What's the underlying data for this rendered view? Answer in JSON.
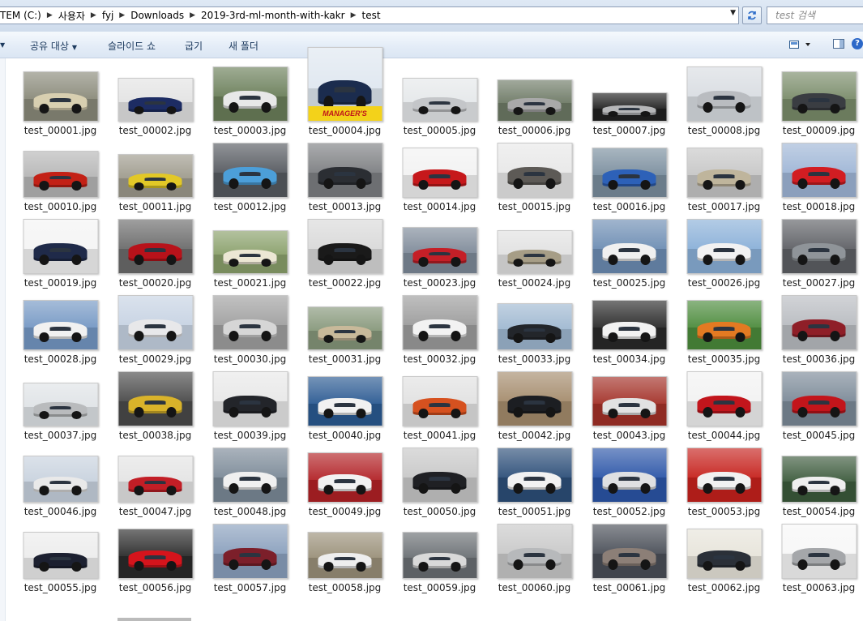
{
  "address": {
    "crumbs": [
      "TEM (C:)",
      "사용자",
      "fyj",
      "Downloads",
      "2019-3rd-ml-month-with-kakr",
      "test"
    ],
    "search_placeholder": "test 검색"
  },
  "toolbar": {
    "share": "공유 대상",
    "slideshow": "슬라이드 쇼",
    "burn": "굽기",
    "new_folder": "새 폴더"
  },
  "files": [
    {
      "name": "test_00001.jpg",
      "color": "#d8cfb0",
      "bg": "#8a8a7a",
      "w": 91,
      "h": 60
    },
    {
      "name": "test_00002.jpg",
      "color": "#1d2c63",
      "bg": "#e3e3e3",
      "w": 91,
      "h": 52
    },
    {
      "name": "test_00003.jpg",
      "color": "#e8e8e8",
      "bg": "#6b7f5a",
      "w": 91,
      "h": 66
    },
    {
      "name": "test_00004.jpg",
      "color": "#1b2c4e",
      "bg": "#dfe7f0",
      "w": 91,
      "h": 90,
      "banner": "MANAGER'S SPECIAL!"
    },
    {
      "name": "test_00005.jpg",
      "color": "#c4c6c9",
      "bg": "#e5e8ea",
      "w": 91,
      "h": 52
    },
    {
      "name": "test_00006.jpg",
      "color": "#a9a9a9",
      "bg": "#6e7a66",
      "w": 91,
      "h": 50
    },
    {
      "name": "test_00007.jpg",
      "color": "#b5b6b8",
      "bg": "#222222",
      "w": 91,
      "h": 34
    },
    {
      "name": "test_00008.jpg",
      "color": "#b9bcc0",
      "bg": "#d9dde2",
      "w": 91,
      "h": 66
    },
    {
      "name": "test_00009.jpg",
      "color": "#3a3d42",
      "bg": "#7a8c6a",
      "w": 91,
      "h": 60
    },
    {
      "name": "test_00010.jpg",
      "color": "#c32116",
      "bg": "#b6b6b6",
      "w": 91,
      "h": 56
    },
    {
      "name": "test_00011.jpg",
      "color": "#e2c827",
      "bg": "#9e9a8c",
      "w": 91,
      "h": 52
    },
    {
      "name": "test_00012.jpg",
      "color": "#4c9fd9",
      "bg": "#565a60",
      "w": 91,
      "h": 66
    },
    {
      "name": "test_00013.jpg",
      "color": "#2b2e33",
      "bg": "#7d7f82",
      "w": 91,
      "h": 66
    },
    {
      "name": "test_00014.jpg",
      "color": "#c6181b",
      "bg": "#f2f2f2",
      "w": 91,
      "h": 60
    },
    {
      "name": "test_00015.jpg",
      "color": "#5d5a56",
      "bg": "#e8e8e8",
      "w": 91,
      "h": 66
    },
    {
      "name": "test_00016.jpg",
      "color": "#2d61b8",
      "bg": "#7a8e9e",
      "w": 91,
      "h": 60
    },
    {
      "name": "test_00017.jpg",
      "color": "#bfb59c",
      "bg": "#c7c7c7",
      "w": 91,
      "h": 60
    },
    {
      "name": "test_00018.jpg",
      "color": "#d21d22",
      "bg": "#9fb6d6",
      "w": 91,
      "h": 66
    },
    {
      "name": "test_00019.jpg",
      "color": "#1f2a49",
      "bg": "#f4f4f4",
      "w": 91,
      "h": 66
    },
    {
      "name": "test_00020.jpg",
      "color": "#b8121a",
      "bg": "#6b6b6b",
      "w": 91,
      "h": 66
    },
    {
      "name": "test_00021.jpg",
      "color": "#ece7d4",
      "bg": "#8aa06b",
      "w": 91,
      "h": 52
    },
    {
      "name": "test_00022.jpg",
      "color": "#1a1a1a",
      "bg": "#d9d9d9",
      "w": 91,
      "h": 66
    },
    {
      "name": "test_00023.jpg",
      "color": "#c51f27",
      "bg": "#7e8a99",
      "w": 91,
      "h": 56
    },
    {
      "name": "test_00024.jpg",
      "color": "#a69d86",
      "bg": "#e1e1e1",
      "w": 91,
      "h": 52
    },
    {
      "name": "test_00025.jpg",
      "color": "#f0f0f0",
      "bg": "#6d8db3",
      "w": 91,
      "h": 66
    },
    {
      "name": "test_00026.jpg",
      "color": "#f2f2f2",
      "bg": "#8ab0d8",
      "w": 91,
      "h": 66
    },
    {
      "name": "test_00027.jpg",
      "color": "#8f9499",
      "bg": "#5e6065",
      "w": 91,
      "h": 66
    },
    {
      "name": "test_00028.jpg",
      "color": "#f1f1f1",
      "bg": "#7598c4",
      "w": 91,
      "h": 60
    },
    {
      "name": "test_00029.jpg",
      "color": "#e8e8ea",
      "bg": "#c7d3e3",
      "w": 91,
      "h": 66
    },
    {
      "name": "test_00030.jpg",
      "color": "#d6d6d6",
      "bg": "#a0a0a0",
      "w": 91,
      "h": 66
    },
    {
      "name": "test_00031.jpg",
      "color": "#c8b99a",
      "bg": "#86977a",
      "w": 91,
      "h": 52
    },
    {
      "name": "test_00032.jpg",
      "color": "#f2f2f2",
      "bg": "#9c9c9c",
      "w": 91,
      "h": 66
    },
    {
      "name": "test_00033.jpg",
      "color": "#23262b",
      "bg": "#9fb8d1",
      "w": 91,
      "h": 56
    },
    {
      "name": "test_00034.jpg",
      "color": "#f2f2f2",
      "bg": "#2a2a2a",
      "w": 91,
      "h": 60
    },
    {
      "name": "test_00035.jpg",
      "color": "#e37a22",
      "bg": "#4c8b3c",
      "w": 91,
      "h": 60
    },
    {
      "name": "test_00036.jpg",
      "color": "#8f1f28",
      "bg": "#b9bcc1",
      "w": 91,
      "h": 66
    },
    {
      "name": "test_00037.jpg",
      "color": "#b9bbbd",
      "bg": "#dfe3e6",
      "w": 91,
      "h": 52
    },
    {
      "name": "test_00038.jpg",
      "color": "#d9b32a",
      "bg": "#4a4a4a",
      "w": 91,
      "h": 66
    },
    {
      "name": "test_00039.jpg",
      "color": "#23252a",
      "bg": "#e8e8e8",
      "w": 91,
      "h": 66
    },
    {
      "name": "test_00040.jpg",
      "color": "#f1f1f1",
      "bg": "#2b5a92",
      "w": 91,
      "h": 60
    },
    {
      "name": "test_00041.jpg",
      "color": "#d6511f",
      "bg": "#e1e1e1",
      "w": 91,
      "h": 60
    },
    {
      "name": "test_00042.jpg",
      "color": "#1c1e22",
      "bg": "#a58c6d",
      "w": 91,
      "h": 66
    },
    {
      "name": "test_00043.jpg",
      "color": "#e2e2e2",
      "bg": "#a33128",
      "w": 91,
      "h": 60
    },
    {
      "name": "test_00044.jpg",
      "color": "#c2151c",
      "bg": "#f2f2f2",
      "w": 91,
      "h": 66
    },
    {
      "name": "test_00045.jpg",
      "color": "#c3151b",
      "bg": "#7c8a98",
      "w": 91,
      "h": 66
    },
    {
      "name": "test_00046.jpg",
      "color": "#e9e9e9",
      "bg": "#c8d2de",
      "w": 91,
      "h": 56
    },
    {
      "name": "test_00047.jpg",
      "color": "#c21e26",
      "bg": "#e4e4e4",
      "w": 91,
      "h": 56
    },
    {
      "name": "test_00048.jpg",
      "color": "#f0f0f0",
      "bg": "#7c8a98",
      "w": 91,
      "h": 66
    },
    {
      "name": "test_00049.jpg",
      "color": "#f2f2f2",
      "bg": "#b22226",
      "w": 91,
      "h": 60
    },
    {
      "name": "test_00050.jpg",
      "color": "#1f2024",
      "bg": "#c8c8c8",
      "w": 91,
      "h": 66
    },
    {
      "name": "test_00051.jpg",
      "color": "#f2f2f2",
      "bg": "#2d4f79",
      "w": 91,
      "h": 66
    },
    {
      "name": "test_00052.jpg",
      "color": "#dfe0e2",
      "bg": "#2c56a8",
      "w": 91,
      "h": 66
    },
    {
      "name": "test_00053.jpg",
      "color": "#f1f1f1",
      "bg": "#c6221d",
      "w": 91,
      "h": 66
    },
    {
      "name": "test_00054.jpg",
      "color": "#efefef",
      "bg": "#3c5a3c",
      "w": 91,
      "h": 56
    },
    {
      "name": "test_00055.jpg",
      "color": "#1c2030",
      "bg": "#ececec",
      "w": 91,
      "h": 56
    },
    {
      "name": "test_00056.jpg",
      "color": "#d5141c",
      "bg": "#2b2b2b",
      "w": 91,
      "h": 60
    },
    {
      "name": "test_00057.jpg",
      "color": "#7c1f2a",
      "bg": "#8aa0bd",
      "w": 91,
      "h": 66
    },
    {
      "name": "test_00058.jpg",
      "color": "#eeeeee",
      "bg": "#9a9079",
      "w": 91,
      "h": 56
    },
    {
      "name": "test_00059.jpg",
      "color": "#d9d9d9",
      "bg": "#6a6f73",
      "w": 91,
      "h": 56
    },
    {
      "name": "test_00060.jpg",
      "color": "#b7b9bb",
      "bg": "#c9c9c9",
      "w": 91,
      "h": 66
    },
    {
      "name": "test_00061.jpg",
      "color": "#8c7f77",
      "bg": "#4a4f58",
      "w": 91,
      "h": 66
    },
    {
      "name": "test_00062.jpg",
      "color": "#2b3038",
      "bg": "#e7e4da",
      "w": 91,
      "h": 60
    },
    {
      "name": "test_00063.jpg",
      "color": "#a5a7aa",
      "bg": "#f7f7f7",
      "w": 91,
      "h": 66
    }
  ]
}
